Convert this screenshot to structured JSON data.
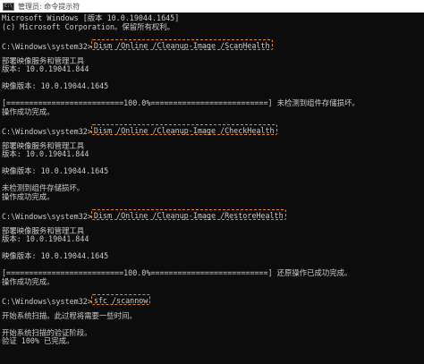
{
  "window": {
    "title": "管理员: 命令提示符",
    "icon_text": "C:\\_",
    "icon_name": "cmd-icon"
  },
  "colors": {
    "background": "#0c0c0c",
    "text": "#cccccc",
    "highlight_border": "#e8862a"
  },
  "console": {
    "prompt": "C:\\Windows\\system32>",
    "lines": [
      {
        "text": "Microsoft Windows [版本 10.0.19044.1645]"
      },
      {
        "text": "(c) Microsoft Corporation。保留所有权利。"
      },
      {
        "text": ""
      },
      {
        "prompt": true,
        "cmd": "Dism /Online /Cleanup-Image /ScanHealth"
      },
      {
        "text": ""
      },
      {
        "text": "部署映像服务和管理工具"
      },
      {
        "text": "版本: 10.0.19041.844"
      },
      {
        "text": ""
      },
      {
        "text": "映像版本: 10.0.19044.1645"
      },
      {
        "text": ""
      },
      {
        "text": "[==========================100.0%==========================] 未检测到组件存储损坏。"
      },
      {
        "text": "操作成功完成。"
      },
      {
        "text": ""
      },
      {
        "prompt": true,
        "cmd": "Dism /Online /Cleanup-Image /CheckHealth"
      },
      {
        "text": ""
      },
      {
        "text": "部署映像服务和管理工具"
      },
      {
        "text": "版本: 10.0.19041.844"
      },
      {
        "text": ""
      },
      {
        "text": "映像版本: 10.0.19044.1645"
      },
      {
        "text": ""
      },
      {
        "text": "未检测到组件存储损坏。"
      },
      {
        "text": "操作成功完成。"
      },
      {
        "text": ""
      },
      {
        "prompt": true,
        "cmd": "Dism /Online /Cleanup-Image /RestoreHealth"
      },
      {
        "text": ""
      },
      {
        "text": "部署映像服务和管理工具"
      },
      {
        "text": "版本: 10.0.19041.844"
      },
      {
        "text": ""
      },
      {
        "text": "映像版本: 10.0.19044.1645"
      },
      {
        "text": ""
      },
      {
        "text": "[==========================100.0%==========================] 还原操作已成功完成。"
      },
      {
        "text": "操作成功完成。"
      },
      {
        "text": ""
      },
      {
        "prompt": true,
        "cmd": "sfc /scannow"
      },
      {
        "text": ""
      },
      {
        "text": "开始系统扫描。此过程将需要一些时间。"
      },
      {
        "text": ""
      },
      {
        "text": "开始系统扫描的验证阶段。"
      },
      {
        "text": "验证 100% 已完成。"
      }
    ]
  }
}
